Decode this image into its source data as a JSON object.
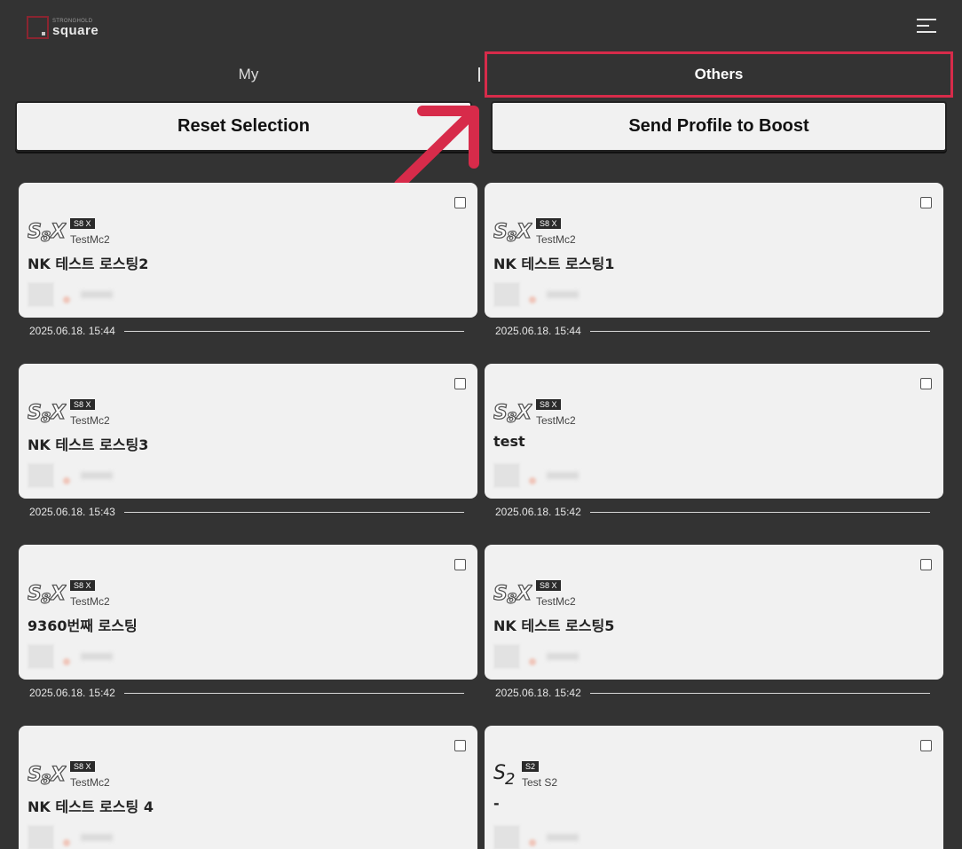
{
  "header": {
    "logo_top": "STRONGHOLD",
    "logo_main": "square"
  },
  "tabs": [
    {
      "label": "My",
      "active": false
    },
    {
      "label": "Others",
      "active": true
    }
  ],
  "actions": {
    "reset_label": "Reset Selection",
    "send_label": "Send Profile to Boost"
  },
  "cards": [
    {
      "badge": "S8 X",
      "user": "TestMc2",
      "title": "NK 테스트 로스팅2",
      "date": "2025.06.18. 15:44",
      "logo": "s8x-logo"
    },
    {
      "badge": "S8 X",
      "user": "TestMc2",
      "title": "NK 테스트 로스팅1",
      "date": "2025.06.18. 15:44",
      "logo": "s8x-logo"
    },
    {
      "badge": "S8 X",
      "user": "TestMc2",
      "title": "NK 테스트 로스팅3",
      "date": "2025.06.18. 15:43",
      "logo": "s8x-logo"
    },
    {
      "badge": "S8 X",
      "user": "TestMc2",
      "title": "test",
      "date": "2025.06.18. 15:42",
      "logo": "s8x-logo"
    },
    {
      "badge": "S8 X",
      "user": "TestMc2",
      "title": "9360번째 로스팅",
      "date": "2025.06.18. 15:42",
      "logo": "s8x-logo"
    },
    {
      "badge": "S8 X",
      "user": "TestMc2",
      "title": "NK 테스트 로스팅5",
      "date": "2025.06.18. 15:42",
      "logo": "s8x-logo"
    },
    {
      "badge": "S8 X",
      "user": "TestMc2",
      "title": "NK 테스트 로스팅 4",
      "date": "",
      "logo": "s8x-logo"
    },
    {
      "badge": "S2",
      "user": "Test S2",
      "title": "-",
      "date": "",
      "logo": "s2-logo"
    }
  ],
  "colors": {
    "background": "#333333",
    "card": "#f1f1f1",
    "accent": "#d72b4a"
  }
}
